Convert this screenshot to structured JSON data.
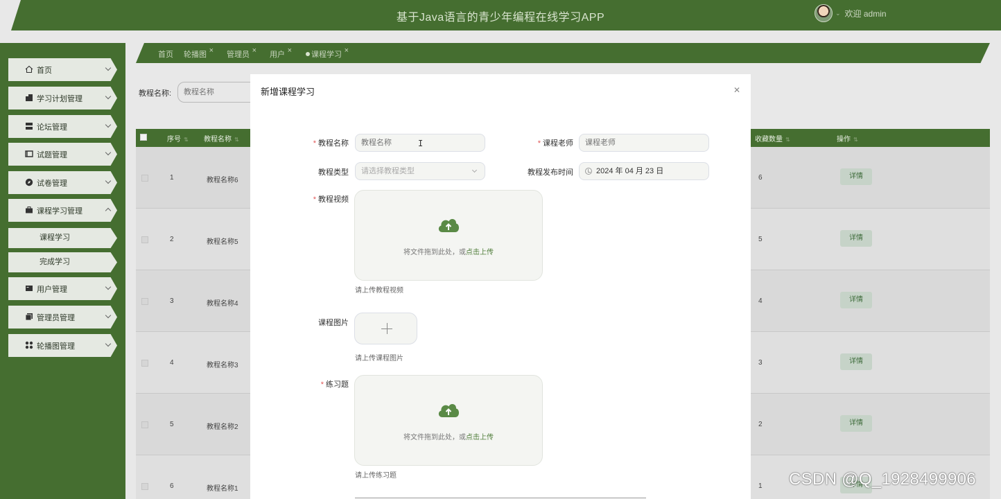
{
  "app": {
    "title": "基于Java语言的青少年编程在线学习APP",
    "welcome": "欢迎 admin"
  },
  "sidebar": {
    "items": [
      {
        "label": "首页",
        "icon": "home-icon"
      },
      {
        "label": "学习计划管理",
        "icon": "building-icon"
      },
      {
        "label": "论坛管理",
        "icon": "server-icon"
      },
      {
        "label": "试题管理",
        "icon": "ticket-icon"
      },
      {
        "label": "试卷管理",
        "icon": "compass-icon"
      },
      {
        "label": "课程学习管理",
        "icon": "briefcase-icon"
      },
      {
        "label": "用户管理",
        "icon": "id-card-icon"
      },
      {
        "label": "管理员管理",
        "icon": "copy-icon"
      },
      {
        "label": "轮播图管理",
        "icon": "grid-icon"
      }
    ],
    "subitems": [
      "课程学习",
      "完成学习"
    ]
  },
  "tabs": [
    {
      "label": "首页",
      "closable": false
    },
    {
      "label": "轮播图",
      "closable": true
    },
    {
      "label": "管理员",
      "closable": true
    },
    {
      "label": "用户",
      "closable": true
    },
    {
      "label": "课程学习",
      "closable": true,
      "active": true
    }
  ],
  "search": {
    "label": "教程名称:",
    "placeholder": "教程名称"
  },
  "table": {
    "columns": [
      "序号",
      "教程名称",
      "收藏数量",
      "操作"
    ],
    "rows": [
      {
        "index": "1",
        "name": "教程名称6",
        "favorites": "6",
        "action": "详情"
      },
      {
        "index": "2",
        "name": "教程名称5",
        "favorites": "5",
        "action": "详情"
      },
      {
        "index": "3",
        "name": "教程名称4",
        "favorites": "4",
        "action": "详情"
      },
      {
        "index": "4",
        "name": "教程名称3",
        "favorites": "3",
        "action": "详情"
      },
      {
        "index": "5",
        "name": "教程名称2",
        "favorites": "2",
        "action": "详情"
      },
      {
        "index": "6",
        "name": "教程名称1",
        "favorites": "1",
        "action": "详情"
      }
    ]
  },
  "modal": {
    "title": "新增课程学习",
    "close_icon": "close-icon",
    "fields": {
      "name": {
        "label": "教程名称",
        "placeholder": "教程名称",
        "required": true
      },
      "teacher": {
        "label": "课程老师",
        "placeholder": "课程老师",
        "required": true
      },
      "type": {
        "label": "教程类型",
        "placeholder": "请选择教程类型"
      },
      "publish_time": {
        "label": "教程发布时间",
        "value": "2024 年 04 月 23 日"
      },
      "video": {
        "label": "教程视频",
        "required": true,
        "drag_text": "将文件拖到此处，或",
        "drag_link": "点击上传",
        "hint": "请上传教程视频"
      },
      "image": {
        "label": "课程图片",
        "hint": "请上传课程图片"
      },
      "exercise": {
        "label": "练习题",
        "required": true,
        "drag_text": "将文件拖到此处，或",
        "drag_link": "点击上传",
        "hint": "请上传练习题"
      }
    }
  },
  "watermark": "CSDN @Q_1928499906",
  "colors": {
    "brand_green": "#456e30",
    "required_red": "#e05656",
    "link_green": "#4f7d3a"
  }
}
